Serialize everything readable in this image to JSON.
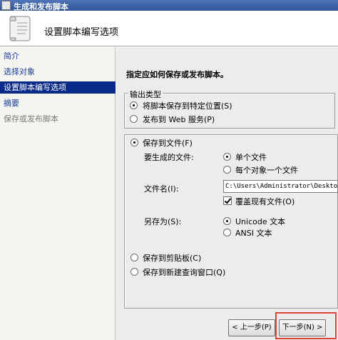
{
  "window": {
    "title": "生成和发布脚本"
  },
  "header": {
    "title": "设置脚本编写选项"
  },
  "sidebar": {
    "items": [
      {
        "label": "简介",
        "state": "link"
      },
      {
        "label": "选择对象",
        "state": "link"
      },
      {
        "label": "设置脚本编写选项",
        "state": "selected"
      },
      {
        "label": "摘要",
        "state": "link"
      },
      {
        "label": "保存或发布脚本",
        "state": "disabled"
      }
    ]
  },
  "main": {
    "instruction": "指定应如何保存或发布脚本。",
    "output_type": {
      "legend": "输出类型",
      "options": [
        {
          "label": "将脚本保存到特定位置(S)",
          "selected": true
        },
        {
          "label": "发布到 Web 服务(P)",
          "selected": false
        }
      ]
    },
    "save_to_file": {
      "label": "保存到文件(F)",
      "selected": true,
      "files_label": "要生成的文件:",
      "file_options": [
        {
          "label": "单个文件",
          "selected": true
        },
        {
          "label": "每个对象一个文件",
          "selected": false
        }
      ],
      "filename_label": "文件名(I):",
      "filename_value": "C:\\Users\\Administrator\\Desktop",
      "overwrite_label": "覆盖现有文件(O)",
      "overwrite_checked": true,
      "save_as_label": "另存为(S):",
      "encoding_options": [
        {
          "label": "Unicode 文本",
          "selected": true
        },
        {
          "label": "ANSI 文本",
          "selected": false
        }
      ]
    },
    "save_clipboard": {
      "label": "保存到剪贴板(C)",
      "selected": false
    },
    "save_query_window": {
      "label": "保存到新建查询窗口(Q)",
      "selected": false
    }
  },
  "buttons": {
    "previous": "< 上一步(P)",
    "next": "下一步(N) >"
  },
  "colors": {
    "selected_nav": "#0a2a8a",
    "highlight": "#e0413a",
    "link": "#1a3e9a"
  },
  "icons": {
    "header": "script-scroll-icon"
  }
}
